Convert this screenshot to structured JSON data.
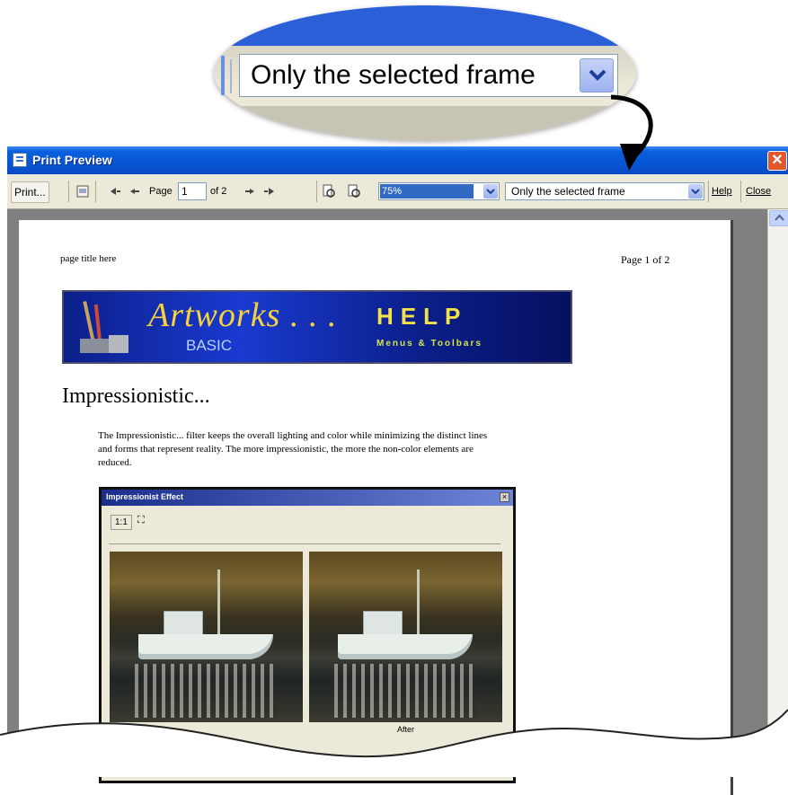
{
  "callout": {
    "selected_value": "Only the selected frame",
    "dropdown_icon": "chevron-down-icon"
  },
  "window": {
    "title": "Print Preview",
    "title_icon": "print-preview-icon",
    "close_icon": "close-icon",
    "close_glyph": "✕"
  },
  "toolbar": {
    "print_label": "Print...",
    "page_label": "Page",
    "page_value": "1",
    "page_of": "of 2",
    "zoom_value": "75%",
    "frame_value": "Only the selected frame",
    "help_label": "Help",
    "close_label": "Close",
    "icons": [
      "print-setup-icon",
      "first-page-icon",
      "previous-page-icon",
      "next-page-icon",
      "last-page-icon",
      "zoom-out-icon",
      "zoom-in-icon"
    ]
  },
  "page": {
    "header_left": "page title here",
    "header_right": "Page 1 of 2",
    "banner": {
      "title": "Artworks . . .",
      "subtitle": "BASIC",
      "help": "HELP",
      "menus": "Menus & Toolbars"
    },
    "heading": "Impressionistic...",
    "paragraph": "The Impressionistic... filter keeps the overall lighting and color while minimizing the distinct lines and forms that represent reality.  The more impressionistic, the more the non-color elements are reduced.",
    "screenshot": {
      "title": "Impressionist Effect",
      "close": "×",
      "tool_1to1": "1:1",
      "tool_fit": "⛶",
      "after_label": "After"
    }
  },
  "colors": {
    "titlebar": "#0656d4",
    "selection": "#316ac5",
    "banner": "#0b1f8a",
    "banner_text": "#f7d23a"
  }
}
